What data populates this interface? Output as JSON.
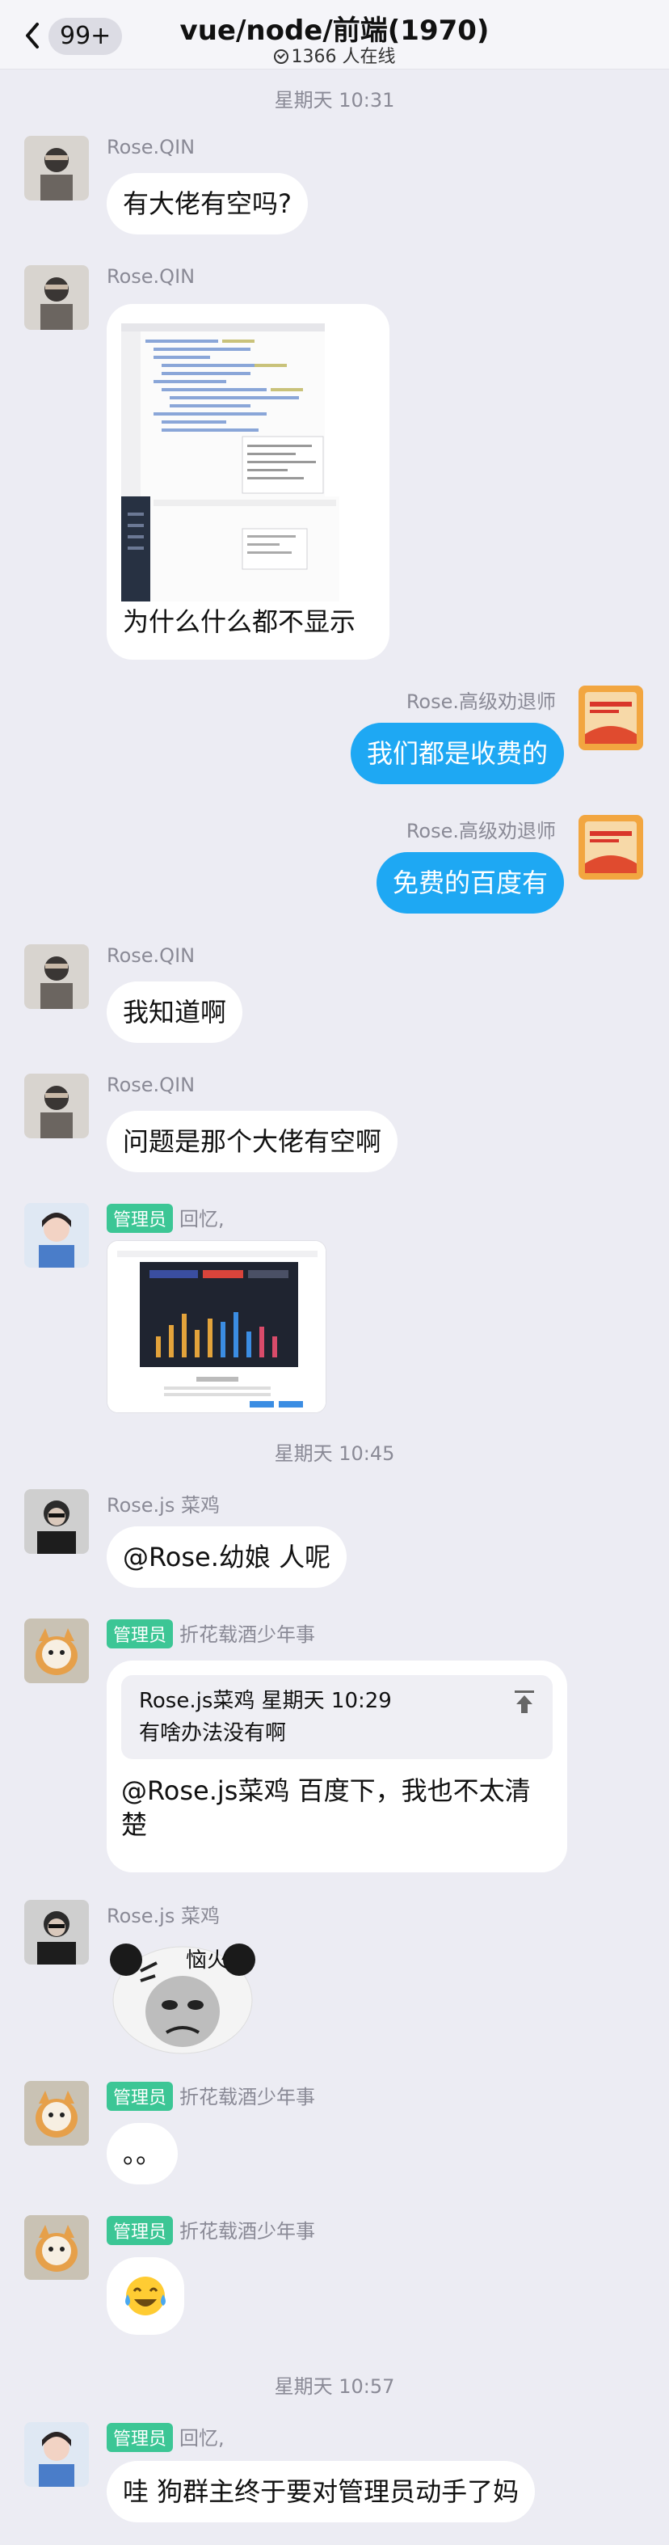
{
  "header": {
    "unread_count": "99+",
    "title": "vue/node/前端(1970)",
    "online": "1366 人在线"
  },
  "timestamps": [
    "星期天 10:31",
    "星期天 10:45",
    "星期天 10:57"
  ],
  "messages": [
    {
      "sender": "Rose.QIN",
      "text": "有大佬有空吗?"
    },
    {
      "sender": "Rose.QIN",
      "text": "为什么什么都不显示"
    },
    {
      "sender": "Rose.高级劝退师",
      "text": "我们都是收费的"
    },
    {
      "sender": "Rose.高级劝退师",
      "text": "免费的百度有"
    },
    {
      "sender": "Rose.QIN",
      "text": "我知道啊"
    },
    {
      "sender": "Rose.QIN",
      "text": "问题是那个大佬有空啊"
    },
    {
      "sender": "回忆,",
      "role": "管理员"
    },
    {
      "sender": "Rose.js 菜鸡",
      "text": "@Rose.幼娘 人呢"
    },
    {
      "sender": "折花载酒少年事",
      "role": "管理员",
      "quote_header": "Rose.js菜鸡 星期天 10:29",
      "quote_text": "有啥办法没有啊",
      "text_line1": "@Rose.js菜鸡 百度下，我也不太清",
      "text_line2": "楚"
    },
    {
      "sender": "Rose.js 菜鸡",
      "sticker_text": "恼火"
    },
    {
      "sender": "折花载酒少年事",
      "role": "管理员",
      "text": "。。"
    },
    {
      "sender": "折花载酒少年事",
      "role": "管理员",
      "emoji": "😂"
    },
    {
      "sender": "回忆,",
      "role": "管理员",
      "text": "哇 狗群主终于要对管理员动手了妈"
    }
  ],
  "colors": {
    "background": "#ececf3",
    "outgoing_bubble": "#1ea8f3",
    "admin_tag": "#3cc695"
  }
}
